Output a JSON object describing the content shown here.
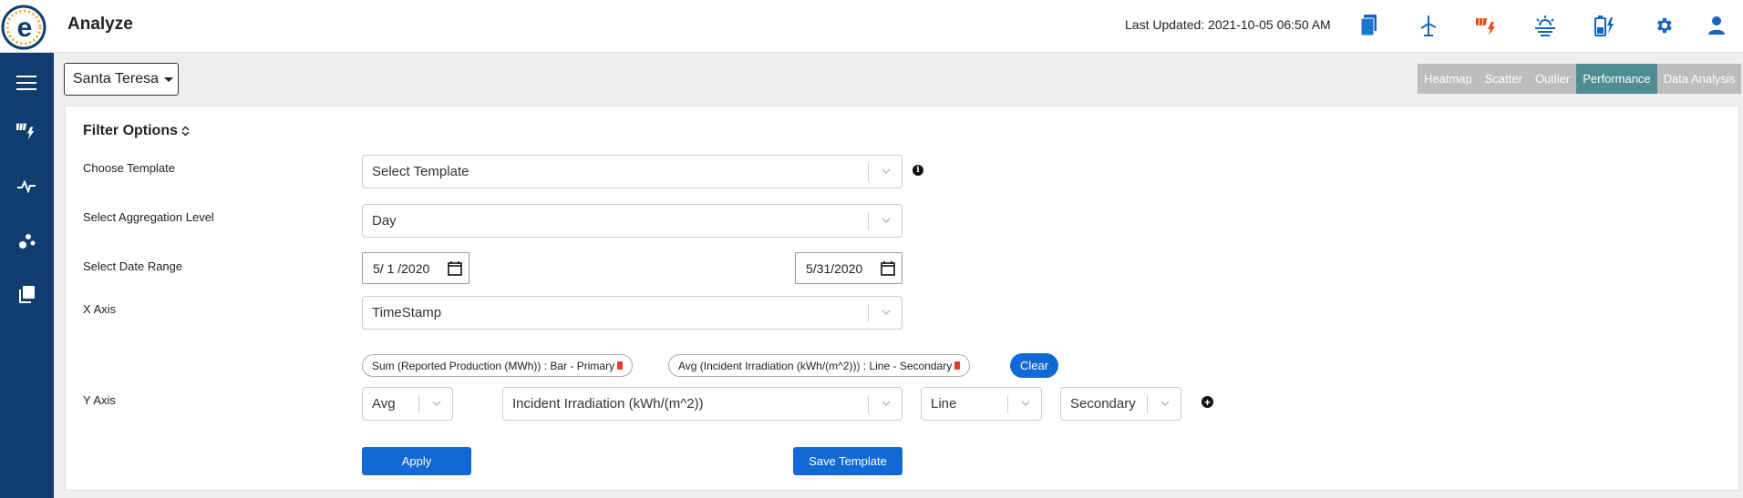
{
  "header": {
    "title": "Analyze",
    "last_updated": "Last Updated: 2021-10-05 06:50 AM",
    "icons": [
      "document-icon",
      "wind-turbine-icon",
      "solar-alert-icon",
      "solar-sun-icon",
      "battery-charge-icon",
      "gear-icon",
      "user-icon"
    ],
    "colors": {
      "primary_blue": "#1169d6",
      "alert_orange": "#e64a19"
    }
  },
  "sidebar": {
    "icons": [
      "menu-icon",
      "solar-icon",
      "pulse-icon",
      "scatter-icon",
      "copy-icon"
    ],
    "background": "#0f3d70"
  },
  "site": {
    "selected": "Santa Teresa"
  },
  "tabs": [
    {
      "label": "Heatmap",
      "active": false
    },
    {
      "label": "Scatter",
      "active": false
    },
    {
      "label": "Outlier",
      "active": false
    },
    {
      "label": "Performance",
      "active": true
    },
    {
      "label": "Data Analysis",
      "active": false
    }
  ],
  "filter": {
    "title": "Filter Options",
    "choose_template": {
      "label": "Choose Template",
      "value": "Select Template"
    },
    "aggregation": {
      "label": "Select Aggregation Level",
      "value": "Day"
    },
    "date_range": {
      "label": "Select Date Range",
      "start": "5/ 1 /2020",
      "end": "5/31/2020"
    },
    "x_axis": {
      "label": "X Axis",
      "value": "TimeStamp"
    },
    "y_axis": {
      "label": "Y Axis",
      "chips": [
        "Sum (Reported Production (MWh)) : Bar - Primary",
        "Avg (Incident Irradiation (kWh/(m^2))) : Line - Secondary"
      ],
      "clear_label": "Clear",
      "function": "Avg",
      "measure": "Incident Irradiation (kWh/(m^2))",
      "chart_type": "Line",
      "axis": "Secondary"
    },
    "apply_label": "Apply",
    "save_template_label": "Save Template"
  }
}
